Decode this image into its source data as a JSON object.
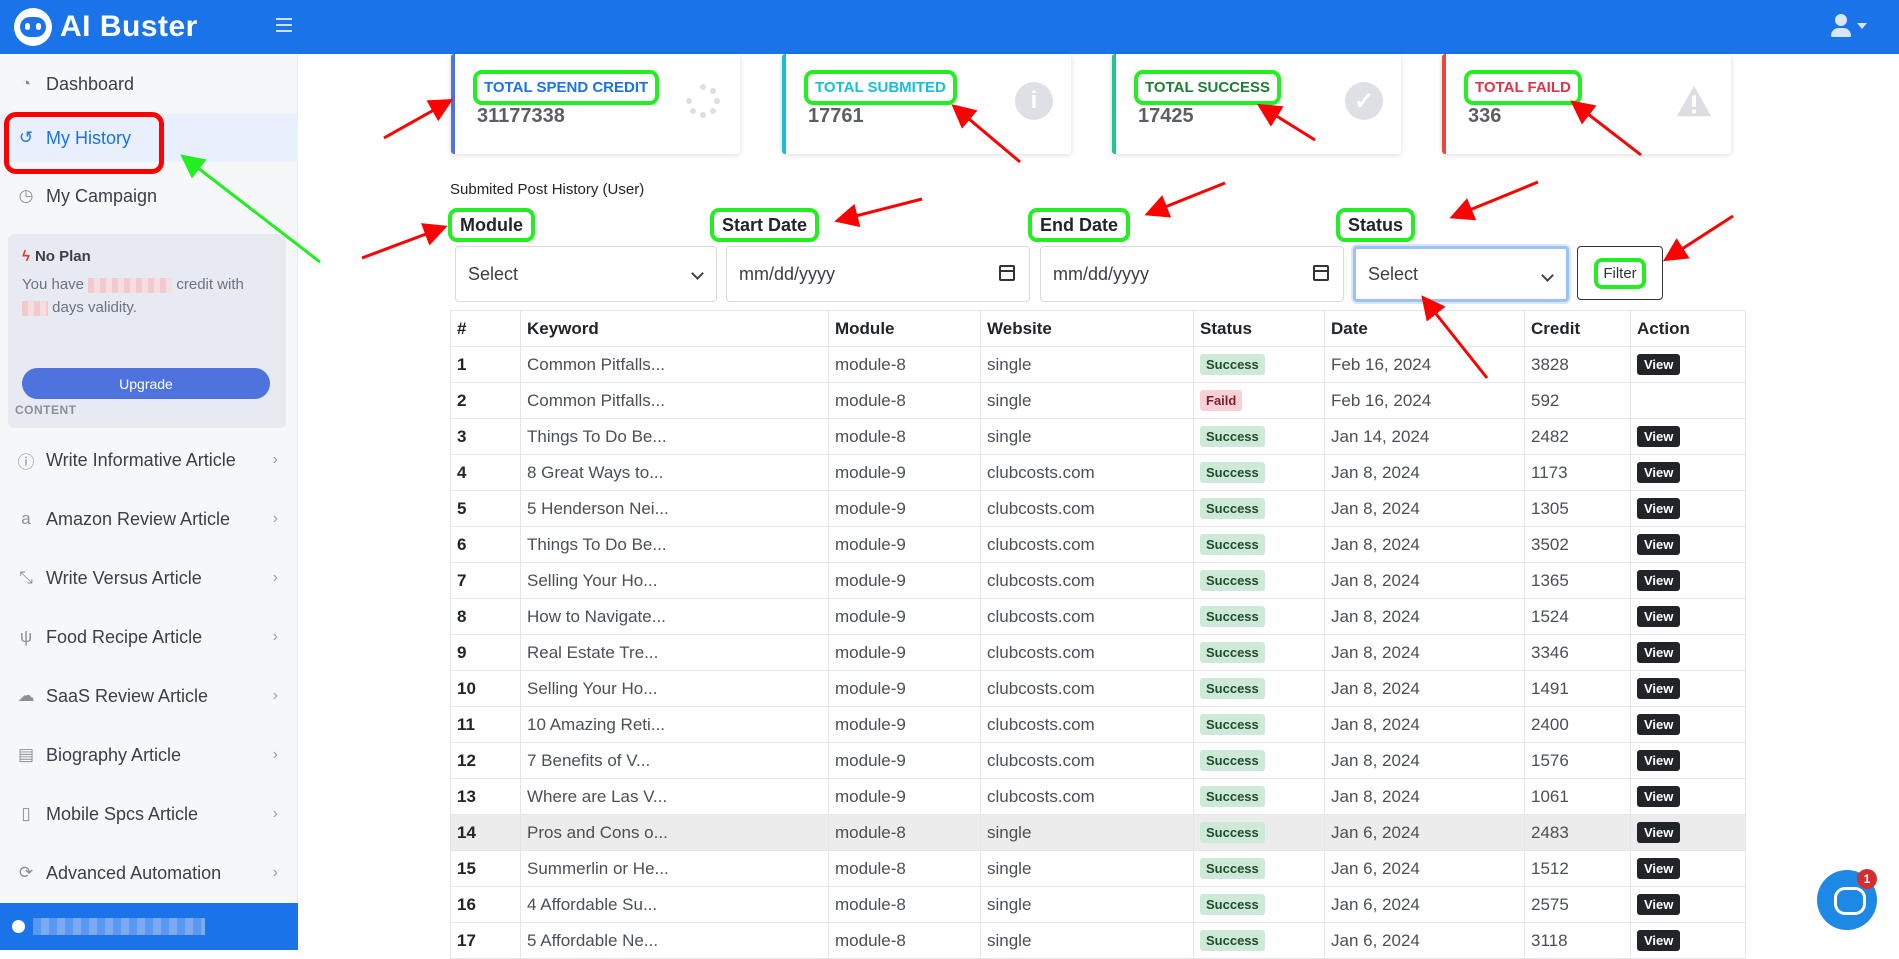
{
  "app": {
    "brand": "AI Buster"
  },
  "sidebar": {
    "top_items": [
      {
        "label": "Dashboard",
        "icon": "dashboard-icon"
      },
      {
        "label": "My History",
        "icon": "history-icon",
        "active": true
      },
      {
        "label": "My Campaign",
        "icon": "clock-icon"
      }
    ],
    "plan": {
      "title": "No Plan",
      "text_a": "You have",
      "text_b": "credit with",
      "text_c": "days validity.",
      "upgrade_label": "Upgrade"
    },
    "section_label": "CONTENT",
    "content_items": [
      {
        "label": "Write Informative Article",
        "icon": "info-icon"
      },
      {
        "label": "Amazon Review Article",
        "icon": "amazon-icon"
      },
      {
        "label": "Write Versus Article",
        "icon": "versus-icon"
      },
      {
        "label": "Food Recipe Article",
        "icon": "utensils-icon"
      },
      {
        "label": "SaaS Review Article",
        "icon": "cloud-icon"
      },
      {
        "label": "Biography Article",
        "icon": "book-icon"
      },
      {
        "label": "Mobile Spcs Article",
        "icon": "mobile-icon"
      },
      {
        "label": "Advanced Automation",
        "icon": "automation-icon"
      }
    ]
  },
  "stats": [
    {
      "label": "TOTAL SPEND CREDIT",
      "value": "31177338",
      "color": "#1a73e8",
      "icon": "spinner-icon"
    },
    {
      "label": "TOTAL SUBMITED",
      "value": "17761",
      "color": "#17c0d8",
      "icon": "info-circle-icon"
    },
    {
      "label": "TOTAL SUCCESS",
      "value": "17425",
      "color": "#1e7e34",
      "icon": "check-circle-icon"
    },
    {
      "label": "TOTAL FAILD",
      "value": "336",
      "color": "#dc3545",
      "icon": "warning-icon"
    }
  ],
  "history": {
    "title": "Submited Post History (User)",
    "filters": {
      "module_label": "Module",
      "module_value": "Select",
      "start_label": "Start Date",
      "start_placeholder": "mm/dd/yyyy",
      "end_label": "End Date",
      "end_placeholder": "mm/dd/yyyy",
      "status_label": "Status",
      "status_value": "Select",
      "filter_button": "Filter"
    },
    "columns": [
      "#",
      "Keyword",
      "Module",
      "Website",
      "Status",
      "Date",
      "Credit",
      "Action"
    ],
    "rows": [
      {
        "n": "1",
        "keyword": "Common Pitfalls...",
        "module": "module-8",
        "website": "single",
        "status": "Success",
        "date": "Feb 16, 2024",
        "credit": "3828",
        "action": "View"
      },
      {
        "n": "2",
        "keyword": "Common Pitfalls...",
        "module": "module-8",
        "website": "single",
        "status": "Faild",
        "date": "Feb 16, 2024",
        "credit": "592",
        "action": ""
      },
      {
        "n": "3",
        "keyword": "Things To Do Be...",
        "module": "module-8",
        "website": "single",
        "status": "Success",
        "date": "Jan 14, 2024",
        "credit": "2482",
        "action": "View"
      },
      {
        "n": "4",
        "keyword": "8 Great Ways to...",
        "module": "module-9",
        "website": "clubcosts.com",
        "status": "Success",
        "date": "Jan 8, 2024",
        "credit": "1173",
        "action": "View"
      },
      {
        "n": "5",
        "keyword": "5 Henderson Nei...",
        "module": "module-9",
        "website": "clubcosts.com",
        "status": "Success",
        "date": "Jan 8, 2024",
        "credit": "1305",
        "action": "View"
      },
      {
        "n": "6",
        "keyword": "Things To Do Be...",
        "module": "module-9",
        "website": "clubcosts.com",
        "status": "Success",
        "date": "Jan 8, 2024",
        "credit": "3502",
        "action": "View"
      },
      {
        "n": "7",
        "keyword": "Selling Your Ho...",
        "module": "module-9",
        "website": "clubcosts.com",
        "status": "Success",
        "date": "Jan 8, 2024",
        "credit": "1365",
        "action": "View"
      },
      {
        "n": "8",
        "keyword": "How to Navigate...",
        "module": "module-9",
        "website": "clubcosts.com",
        "status": "Success",
        "date": "Jan 8, 2024",
        "credit": "1524",
        "action": "View"
      },
      {
        "n": "9",
        "keyword": "Real Estate Tre...",
        "module": "module-9",
        "website": "clubcosts.com",
        "status": "Success",
        "date": "Jan 8, 2024",
        "credit": "3346",
        "action": "View"
      },
      {
        "n": "10",
        "keyword": "Selling Your Ho...",
        "module": "module-9",
        "website": "clubcosts.com",
        "status": "Success",
        "date": "Jan 8, 2024",
        "credit": "1491",
        "action": "View"
      },
      {
        "n": "11",
        "keyword": "10 Amazing Reti...",
        "module": "module-9",
        "website": "clubcosts.com",
        "status": "Success",
        "date": "Jan 8, 2024",
        "credit": "2400",
        "action": "View"
      },
      {
        "n": "12",
        "keyword": "7 Benefits of V...",
        "module": "module-9",
        "website": "clubcosts.com",
        "status": "Success",
        "date": "Jan 8, 2024",
        "credit": "1576",
        "action": "View"
      },
      {
        "n": "13",
        "keyword": "Where are Las V...",
        "module": "module-9",
        "website": "clubcosts.com",
        "status": "Success",
        "date": "Jan 8, 2024",
        "credit": "1061",
        "action": "View"
      },
      {
        "n": "14",
        "keyword": "Pros and Cons o...",
        "module": "module-8",
        "website": "single",
        "status": "Success",
        "date": "Jan 6, 2024",
        "credit": "2483",
        "action": "View"
      },
      {
        "n": "15",
        "keyword": "Summerlin or He...",
        "module": "module-8",
        "website": "single",
        "status": "Success",
        "date": "Jan 6, 2024",
        "credit": "1512",
        "action": "View"
      },
      {
        "n": "16",
        "keyword": "4 Affordable Su...",
        "module": "module-8",
        "website": "single",
        "status": "Success",
        "date": "Jan 6, 2024",
        "credit": "2575",
        "action": "View"
      },
      {
        "n": "17",
        "keyword": "5 Affordable Ne...",
        "module": "module-8",
        "website": "single",
        "status": "Success",
        "date": "Jan 6, 2024",
        "credit": "3118",
        "action": "View"
      }
    ]
  },
  "chat": {
    "badge": "1"
  }
}
